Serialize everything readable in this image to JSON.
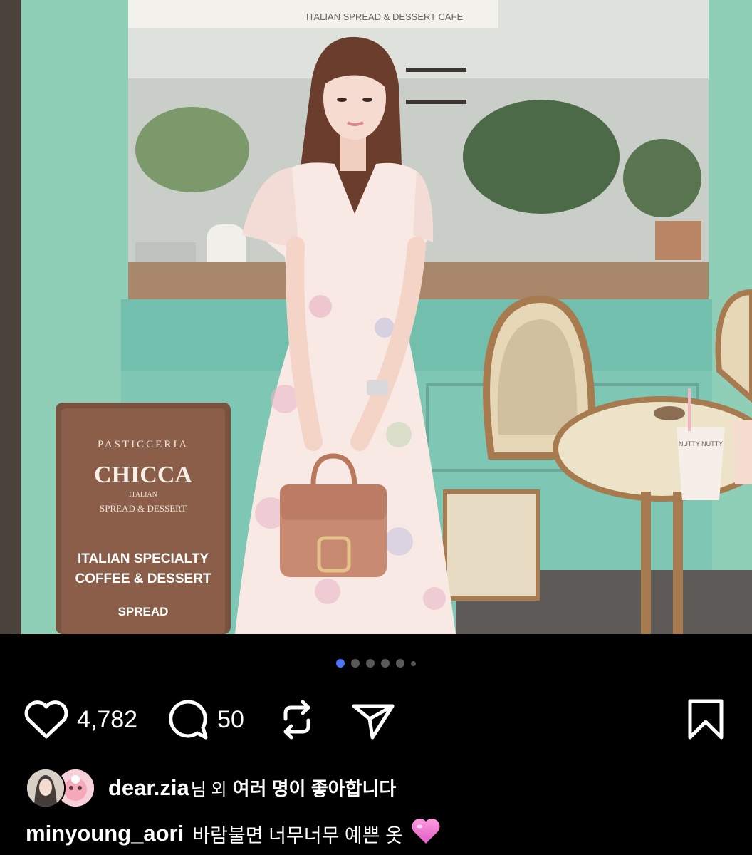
{
  "photo": {
    "awning_text": "ITALIAN SPREAD & DESSERT CAFE",
    "sign": {
      "arc_text": "PASTICCERIA",
      "brand": "CHICCA",
      "sub1": "ITALIAN",
      "sub2": "SPREAD & DESSERT",
      "line1": "ITALIAN SPECIALTY",
      "line2": "COFFEE & DESSERT",
      "line3": "SPREAD"
    },
    "cup_text": "NUTTY NUTTY"
  },
  "carousel": {
    "dot_count": 6,
    "active_index": 0
  },
  "actions": {
    "like": {
      "icon": "heart-outline-icon",
      "count": "4,782"
    },
    "comment": {
      "icon": "speech-bubble-icon",
      "count": "50"
    },
    "repost": {
      "icon": "repost-icon"
    },
    "share": {
      "icon": "paper-plane-icon"
    },
    "save": {
      "icon": "bookmark-icon"
    }
  },
  "likes": {
    "user": "dear.zia",
    "suffix": "님 외",
    "rest": "여러 명이 좋아합니다"
  },
  "caption": {
    "user": "minyoung_aori",
    "text": "바람불면 너무너무 예쁜 옷",
    "emoji": "pink-heart-icon"
  },
  "colors": {
    "background": "#000000",
    "active_dot": "#4c78ff",
    "inactive_dot": "#5a5a5a",
    "storefront": "#8fcfb8"
  }
}
